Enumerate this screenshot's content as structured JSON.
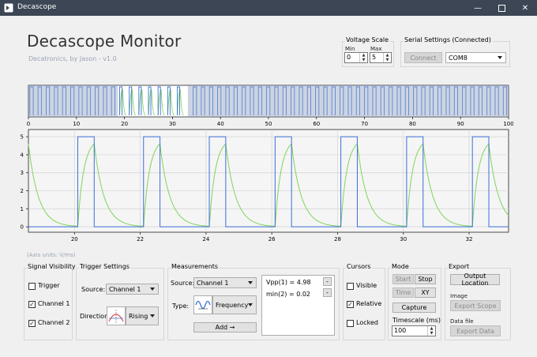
{
  "window": {
    "title": "Decascope"
  },
  "header": {
    "title": "Decascope Monitor",
    "subtitle": "Decatronics, by Jason - v1.0"
  },
  "voltage_scale": {
    "label": "Voltage Scale",
    "min_label": "Min",
    "max_label": "Max",
    "min_value": "0",
    "max_value": "5"
  },
  "serial": {
    "label": "Serial Settings (Connected)",
    "connect_label": "Connect",
    "port": "COM8"
  },
  "overview": {
    "ticks": [
      "0",
      "10",
      "20",
      "30",
      "40",
      "50",
      "60",
      "70",
      "80",
      "90",
      "100"
    ]
  },
  "main_plot": {
    "y_ticks": [
      "5",
      "4",
      "3",
      "2",
      "1",
      "0"
    ],
    "x_ticks": [
      "20",
      "22",
      "24",
      "26",
      "28",
      "30",
      "32"
    ],
    "axis_units": "(Axis units: V/ms)"
  },
  "chart_data": {
    "type": "line",
    "xlim": [
      18.6,
      33.2
    ],
    "ylim": [
      -0.3,
      5.4
    ],
    "x_ticks": [
      20,
      22,
      24,
      26,
      28,
      30,
      32
    ],
    "y_ticks": [
      0,
      1,
      2,
      3,
      4,
      5
    ],
    "grid": true,
    "series": [
      {
        "color": "#3a6fd8",
        "kind": "square",
        "pulse_starts": [
          18.1,
          20.1,
          22.1,
          24.1,
          26.1,
          28.1,
          30.1,
          32.1
        ],
        "pulse_width": 0.5,
        "high": 5,
        "low": 0,
        "period": 2.0
      },
      {
        "color": "#7fd45a",
        "kind": "rc",
        "peak": 4.6,
        "rise_time": 0.5,
        "decay_tau": 0.3
      }
    ]
  },
  "signal_visibility": {
    "label": "Signal Visibility",
    "items": [
      {
        "label": "Trigger",
        "checked": false
      },
      {
        "label": "Channel 1",
        "checked": true
      },
      {
        "label": "Channel 2",
        "checked": true
      }
    ]
  },
  "trigger": {
    "label": "Trigger Settings",
    "source_label": "Source:",
    "source_value": "Channel 1",
    "direction_label": "Direction:",
    "direction_value": "Rising"
  },
  "measurements": {
    "label": "Measurements",
    "source_label": "Source:",
    "source_value": "Channel 1",
    "type_label": "Type:",
    "type_value": "Frequency",
    "add_label": "Add →",
    "list": [
      "Vpp(1) = 4.98",
      "min(2) = 0.02"
    ],
    "remove_label": "-"
  },
  "cursors": {
    "label": "Cursors",
    "items": [
      {
        "label": "Visible",
        "checked": false
      },
      {
        "label": "Relative",
        "checked": true
      },
      {
        "label": "Locked",
        "checked": false
      }
    ]
  },
  "mode": {
    "label": "Mode",
    "start_label": "Start",
    "stop_label": "Stop",
    "time_label": "Time",
    "xy_label": "XY",
    "capture_label": "Capture",
    "timescale_label": "Timescale (ms)",
    "timescale_value": "100"
  },
  "export": {
    "label": "Export",
    "output_location_label": "Output Location",
    "image_label": "Image",
    "export_scope_label": "Export Scope",
    "data_file_label": "Data file",
    "export_data_label": "Export Data"
  },
  "colors": {
    "ch1": "#3a6fd8",
    "ch2": "#7fd45a",
    "titlebar": "#3c4654"
  }
}
